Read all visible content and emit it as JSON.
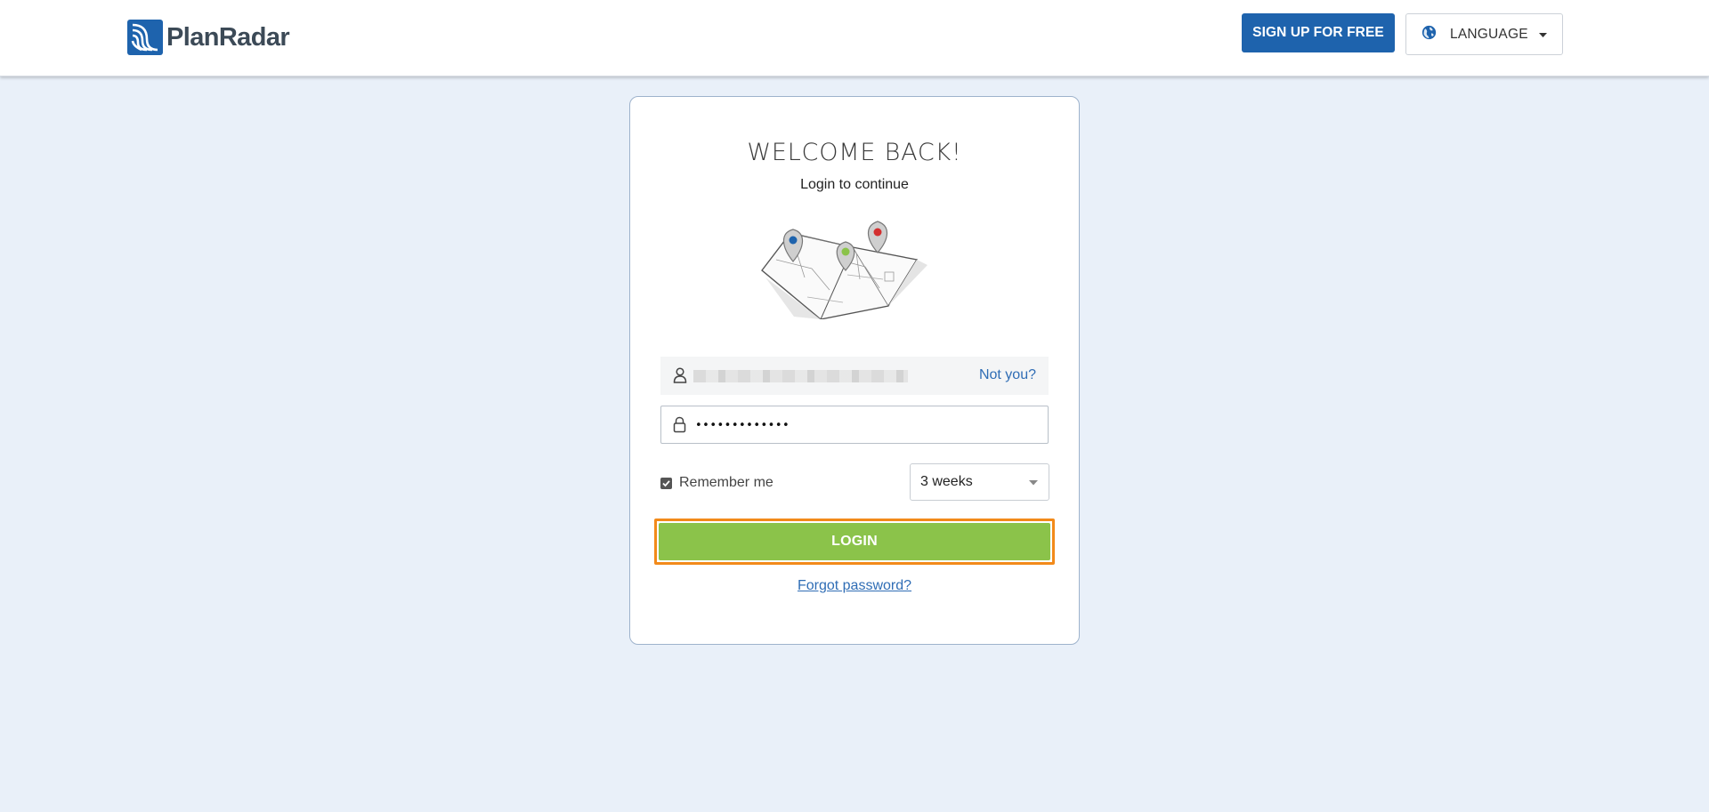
{
  "header": {
    "logo_text": "PlanRadar",
    "signup_label": "SIGN UP FOR FREE",
    "language_label": "LANGUAGE"
  },
  "login_card": {
    "title": "WELCOME BACK!",
    "subtitle": "Login to continue",
    "not_you_label": "Not you?",
    "password_value": "•••••••••••••",
    "remember_me_label": "Remember me",
    "remember_me_checked": true,
    "duration_selected": "3 weeks",
    "login_label": "LOGIN",
    "forgot_label": "Forgot password?"
  },
  "icons": {
    "user_field": "user-icon",
    "password_field": "lock-icon",
    "language": "globe-icon",
    "dropdown": "chevron-down-icon"
  },
  "colors": {
    "primary_blue": "#1e63ad",
    "login_green": "#8bc34a",
    "focus_orange": "#f28a1a",
    "link_blue": "#2f6db5",
    "background": "#e9f0f9"
  }
}
